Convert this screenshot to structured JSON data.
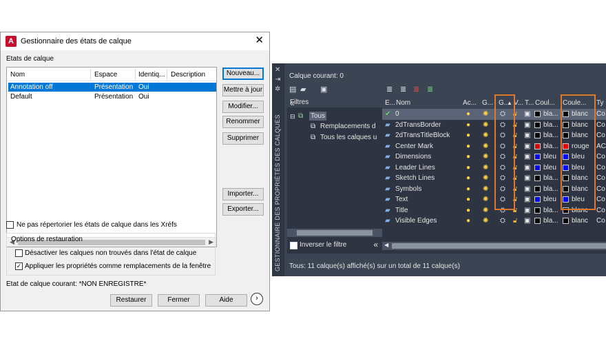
{
  "dialog": {
    "title": "Gestionnaire des états de calque",
    "states_label": "Etats de calque",
    "columns": [
      "Nom",
      "Espace",
      "Identiq...",
      "Description"
    ],
    "rows": [
      {
        "nom": "Annotation off",
        "espace": "Présentation",
        "ident": "Oui",
        "desc": ""
      },
      {
        "nom": "Default",
        "espace": "Présentation",
        "ident": "Oui",
        "desc": ""
      }
    ],
    "buttons": {
      "nouveau": "Nouveau...",
      "mettre_a_jour": "Mettre à jour",
      "modifier": "Modifier...",
      "renommer": "Renommer",
      "supprimer": "Supprimer",
      "importer": "Importer...",
      "exporter": "Exporter...",
      "restaurer": "Restaurer",
      "fermer": "Fermer",
      "aide": "Aide"
    },
    "xrefs_check": "Ne pas répertorier les états de calque dans les Xréfs",
    "restore_group": "Options de restauration",
    "opt1": "Désactiver les calques non trouvés dans l'état de calque",
    "opt2": "Appliquer les propriétés comme remplacements de la fenêtre",
    "opt2_checked": true,
    "current_state": "Etat de calque courant: *NON ENREGISTRE*"
  },
  "palette": {
    "side_title": "GESTIONNAIRE DES PROPRIÉTÉS DES CALQUES",
    "current_layer": "Calque courant: 0",
    "filters_title": "Filtres",
    "tree": [
      "Tous",
      "Remplacements d",
      "Tous les calques u"
    ],
    "invert_filter": "Inverser le filtre",
    "columns": [
      "E...",
      "Nom",
      "Ac...",
      "G...",
      "G...",
      "V...",
      "T...",
      "Coul...",
      "Coule...",
      "Ty"
    ],
    "layers": [
      {
        "name": "0",
        "c1": "bla...",
        "c2": "blanc",
        "ty": "Co",
        "color": "#000000",
        "current": true
      },
      {
        "name": "2dTransBorder",
        "c1": "bla...",
        "c2": "blanc",
        "ty": "Co",
        "color": "#000000"
      },
      {
        "name": "2dTransTitleBlock",
        "c1": "bla...",
        "c2": "blanc",
        "ty": "Co",
        "color": "#000000"
      },
      {
        "name": "Center Mark",
        "c1": "bla...",
        "c2": "rouge",
        "ty": "AC",
        "color": "#e00000"
      },
      {
        "name": "Dimensions",
        "c1": "bleu",
        "c2": "bleu",
        "ty": "Co",
        "color": "#0000ff"
      },
      {
        "name": "Leader Lines",
        "c1": "bleu",
        "c2": "bleu",
        "ty": "Co",
        "color": "#0000ff"
      },
      {
        "name": "Sketch Lines",
        "c1": "bla...",
        "c2": "blanc",
        "ty": "Co",
        "color": "#000000"
      },
      {
        "name": "Symbols",
        "c1": "bla...",
        "c2": "blanc",
        "ty": "Co",
        "color": "#000000"
      },
      {
        "name": "Text",
        "c1": "bleu",
        "c2": "bleu",
        "ty": "Co",
        "color": "#0000ff"
      },
      {
        "name": "Title",
        "c1": "bla...",
        "c2": "blanc",
        "ty": "Co",
        "color": "#000000"
      },
      {
        "name": "Visible Edges",
        "c1": "bla...",
        "c2": "blanc",
        "ty": "Co",
        "color": "#000000"
      }
    ],
    "status": "Tous: 11 calque(s) affiché(s) sur un total de 11 calque(s)"
  },
  "colors": {
    "highlight": "#e0782b",
    "selection": "#0078d7",
    "panel_bg": "#3b4453"
  }
}
